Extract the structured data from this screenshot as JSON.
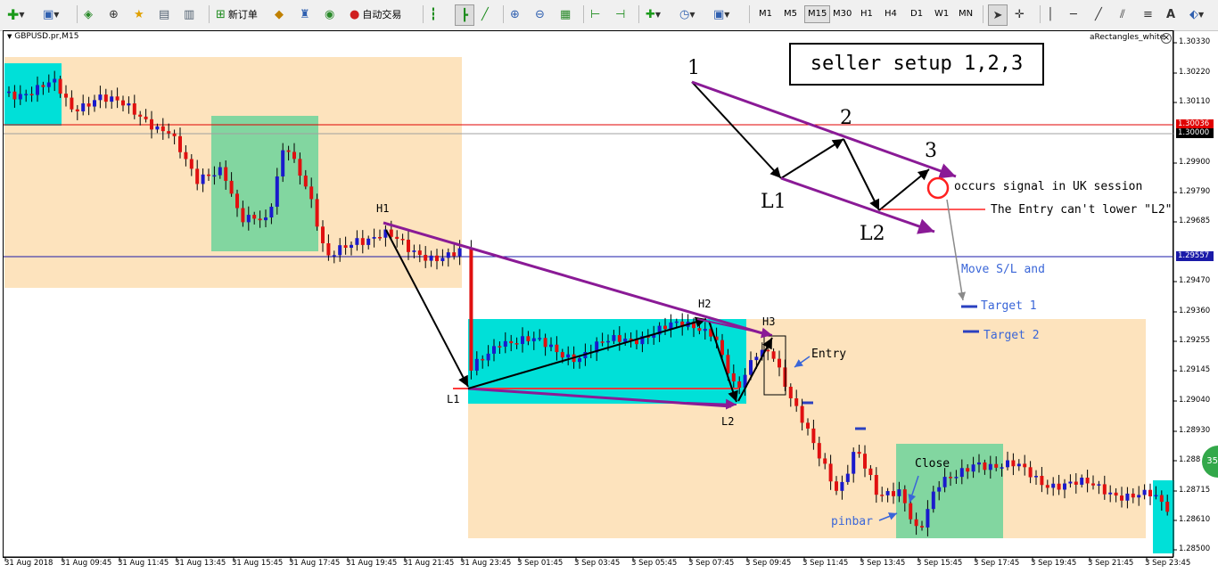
{
  "toolbar": {
    "new_order_label": "新订单",
    "auto_trading_label": "自动交易",
    "timeframes": [
      "M1",
      "M5",
      "M15",
      "M30",
      "H1",
      "H4",
      "D1",
      "W1",
      "MN"
    ],
    "active_timeframe": "M15"
  },
  "chart": {
    "symbol_label": "GBPUSD.pr,M15",
    "indicator_label": "aRectangles_white",
    "colors": {
      "bull_candle": "#1a1acc",
      "bear_candle": "#e01010",
      "wick": "#000000",
      "zone_tan": "#fde3bd",
      "zone_cyan": "#00e0d8",
      "zone_green": "#82d6a0",
      "trend_purple": "#8a1a96",
      "red_level": "#e00000",
      "blue_level": "#1a1aa8",
      "annotation_blue": "#3a66d8"
    }
  },
  "price_axis": {
    "ticks": [
      "1.30330",
      "1.30220",
      "1.30110",
      "1.29900",
      "1.29790",
      "1.29685",
      "1.29470",
      "1.29360",
      "1.29255",
      "1.29145",
      "1.29040",
      "1.28930",
      "1.288",
      "1.28715",
      "1.28610",
      "1.28500"
    ],
    "level_red": "1.30036",
    "level_round": "1.30000",
    "level_blue": "1.29557"
  },
  "time_axis": {
    "labels": [
      "31 Aug 2018",
      "31 Aug 09:45",
      "31 Aug 11:45",
      "31 Aug 13:45",
      "31 Aug 15:45",
      "31 Aug 17:45",
      "31 Aug 19:45",
      "31 Aug 21:45",
      "31 Aug 23:45",
      "3 Sep 01:45",
      "3 Sep 03:45",
      "3 Sep 05:45",
      "3 Sep 07:45",
      "3 Sep 09:45",
      "3 Sep 11:45",
      "3 Sep 13:45",
      "3 Sep 15:45",
      "3 Sep 17:45",
      "3 Sep 19:45",
      "3 Sep 21:45",
      "3 Sep 23:45"
    ]
  },
  "annotations": {
    "setup_title": "seller setup 1,2,3",
    "point_1": "1",
    "point_2": "2",
    "point_3": "3",
    "point_l1": "L1",
    "point_l2": "L2",
    "signal_note": "occurs signal in UK session",
    "entry_note": "The Entry can't lower \"L2\"",
    "move_sl_note": "Move S/L and",
    "target_1": "Target 1",
    "target_2": "Target 2",
    "h1": "H1",
    "h2": "H2",
    "h3": "H3",
    "l1": "L1",
    "l2": "L2",
    "entry": "Entry",
    "close": "Close",
    "pinbar": "pinbar",
    "badge": "35"
  }
}
